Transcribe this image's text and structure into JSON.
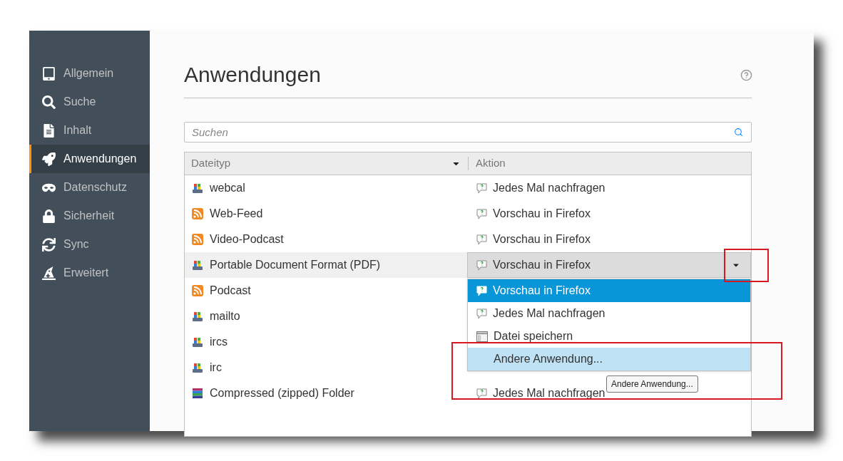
{
  "sidebar": {
    "items": [
      {
        "label": "Allgemein",
        "kind": "general",
        "selected": false
      },
      {
        "label": "Suche",
        "kind": "search",
        "selected": false
      },
      {
        "label": "Inhalt",
        "kind": "content",
        "selected": false
      },
      {
        "label": "Anwendungen",
        "kind": "applications",
        "selected": true
      },
      {
        "label": "Datenschutz",
        "kind": "privacy",
        "selected": false
      },
      {
        "label": "Sicherheit",
        "kind": "security",
        "selected": false
      },
      {
        "label": "Sync",
        "kind": "sync",
        "selected": false
      },
      {
        "label": "Erweitert",
        "kind": "advanced",
        "selected": false
      }
    ]
  },
  "page": {
    "title": "Anwendungen"
  },
  "search": {
    "placeholder": "Suchen"
  },
  "table": {
    "columns": [
      {
        "label": "Dateityp",
        "sorted": true
      },
      {
        "label": "Aktion",
        "sorted": false
      }
    ],
    "rows": [
      {
        "type": "webcal",
        "kind": "app",
        "selected": false,
        "action": {
          "label": "Jedes Mal nachfragen",
          "kind": "ask"
        }
      },
      {
        "type": "Web-Feed",
        "kind": "feed",
        "selected": false,
        "action": {
          "label": "Vorschau in Firefox",
          "kind": "ask"
        }
      },
      {
        "type": "Video-Podcast",
        "kind": "feed",
        "selected": false,
        "action": {
          "label": "Vorschau in Firefox",
          "kind": "ask"
        }
      },
      {
        "type": "Portable Document Format (PDF)",
        "kind": "app",
        "selected": true,
        "action": {
          "label": "Vorschau in Firefox",
          "kind": "ask"
        }
      },
      {
        "type": "Podcast",
        "kind": "feed",
        "selected": false
      },
      {
        "type": "mailto",
        "kind": "app",
        "selected": false
      },
      {
        "type": "ircs",
        "kind": "app",
        "selected": false
      },
      {
        "type": "irc",
        "kind": "app",
        "selected": false
      },
      {
        "type": "Compressed (zipped) Folder",
        "kind": "archive",
        "selected": false,
        "action": {
          "label": "Jedes Mal nachfragen",
          "kind": "ask"
        },
        "tooltip": "Andere Anwendung..."
      }
    ]
  },
  "dropdown": {
    "items": [
      {
        "label": "Vorschau in Firefox",
        "kind": "ask",
        "selected": true,
        "hovered": false
      },
      {
        "label": "Jedes Mal nachfragen",
        "kind": "ask",
        "selected": false,
        "hovered": false
      },
      {
        "label": "Datei speichern",
        "kind": "save",
        "selected": false,
        "hovered": false
      },
      {
        "label": "Andere Anwendung...",
        "kind": "other",
        "selected": false,
        "hovered": true
      }
    ]
  }
}
